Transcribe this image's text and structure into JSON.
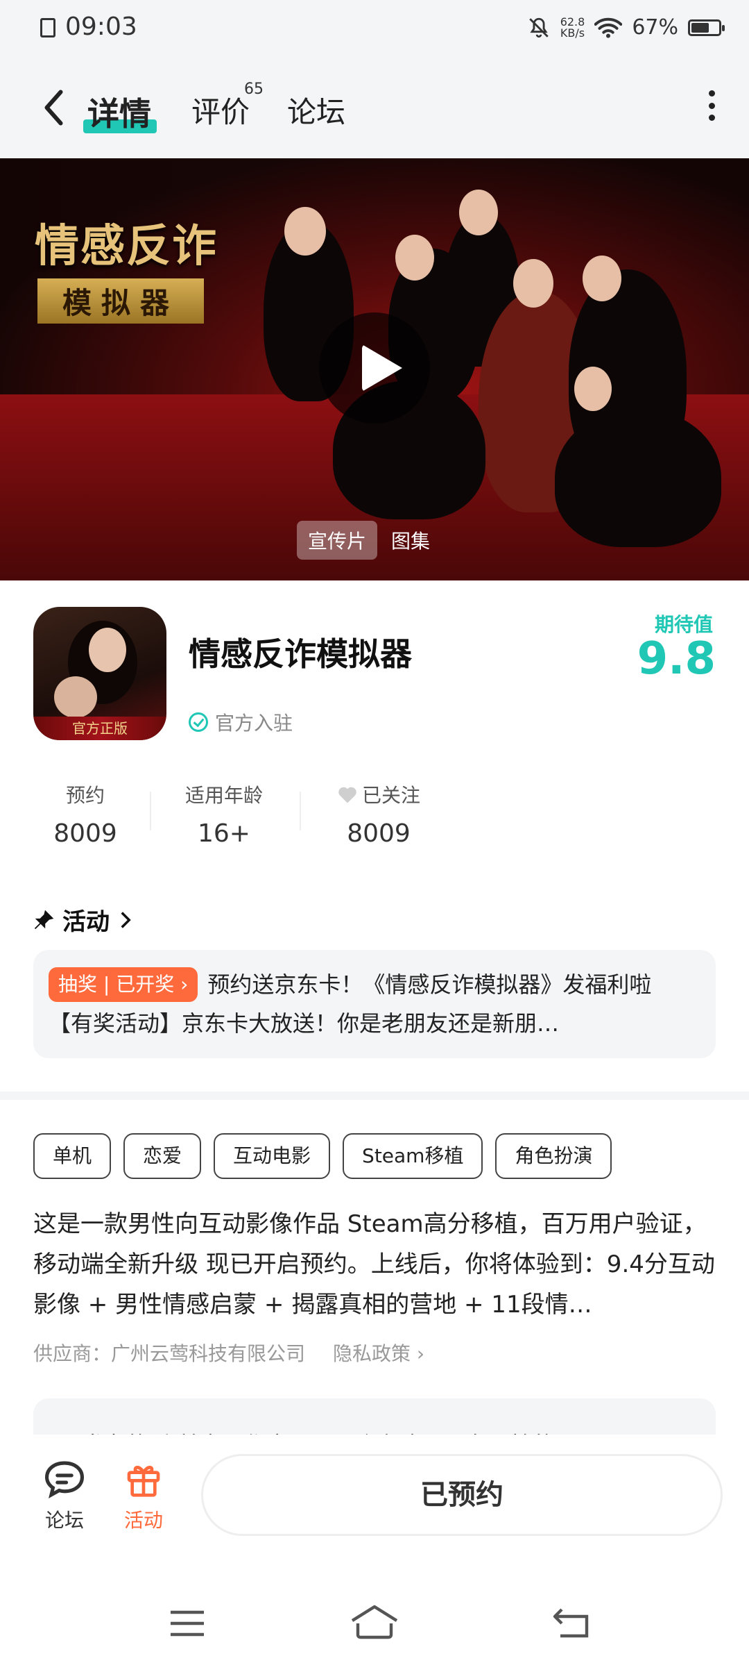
{
  "status_bar": {
    "time": "09:03",
    "net_speed_value": "62.8",
    "net_speed_unit": "KB/s",
    "battery_pct": "67%",
    "battery_level": 0.67,
    "icons": [
      "sim-icon",
      "mute-icon",
      "wifi-icon",
      "battery-icon"
    ]
  },
  "nav": {
    "tabs": [
      {
        "label": "详情",
        "active": true
      },
      {
        "label": "评价",
        "badge": "65"
      },
      {
        "label": "论坛"
      }
    ]
  },
  "hero": {
    "title_line1": "情感反诈",
    "title_line2": "模拟器",
    "segments": [
      "宣传片",
      "图集"
    ]
  },
  "app": {
    "icon_caption": "官方正版",
    "name": "情感反诈模拟器",
    "verified_label": "官方入驻",
    "expect_label": "期待值",
    "expect_value": "9.8",
    "accent_color": "#20c7b5"
  },
  "stats": [
    {
      "label": "预约",
      "value": "8009"
    },
    {
      "label": "适用年龄",
      "value": "16+"
    },
    {
      "label": "已关注",
      "value": "8009"
    }
  ],
  "activity": {
    "title": "活动",
    "tag": "抽奖 | 已开奖 ›",
    "text": "预约送京东卡！《情感反诈模拟器》发福利啦 【有奖活动】京东卡大放送！你是老朋友还是新朋…",
    "tag_color": "#ff6a3c"
  },
  "tags": [
    "单机",
    "恋爱",
    "互动电影",
    "Steam移植",
    "角色扮演"
  ],
  "description": "这是一款男性向互动影像作品 Steam高分移植，百万用户验证，移动端全新升级 现已开启预约。上线后，你将体验到：9.4分互动影像 + 男性情感启蒙 + 揭露真相的营地 + 11段情…",
  "supplier": {
    "label": "供应商：广州云莺科技有限公司",
    "privacy": "隐私政策 ›"
  },
  "peek_text": "开发者的话 首充工作室一另一个有这不服务男性的…男",
  "bottom_bar": {
    "forum_label": "论坛",
    "activity_label": "活动",
    "reserve_label": "已预约",
    "active_color": "#ff6a3c"
  }
}
